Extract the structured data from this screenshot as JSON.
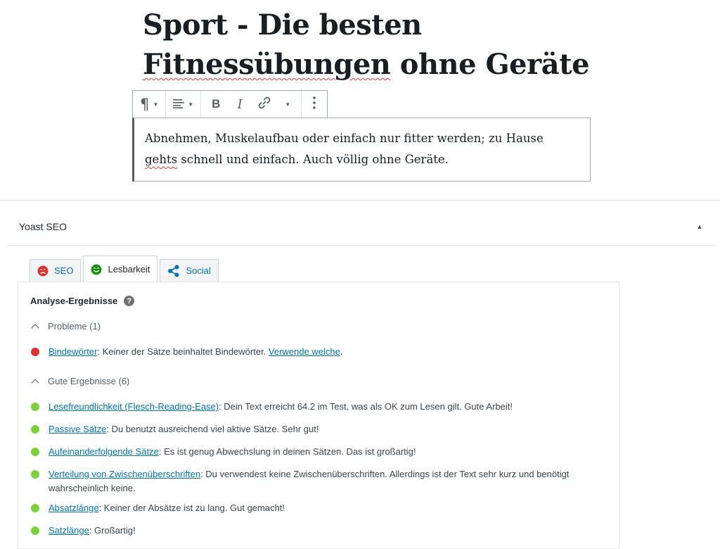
{
  "editor": {
    "title_line1": "Sport - Die besten",
    "title_word_misspelled": "Fitnessübungen",
    "title_line2_rest": " ohne Geräte",
    "paragraph_part1": "Abnehmen, Muskelaufbau oder einfach nur fitter werden; zu Hause ",
    "paragraph_misspelled": "gehts",
    "paragraph_part2": " schnell und einfach. Auch völlig ohne Geräte.",
    "toolbar": {
      "paragraph_icon": "pilcrow-icon",
      "align_icon": "align-left-icon",
      "bold_label": "B",
      "italic_label": "I",
      "link_icon": "link-icon",
      "more_icon": "more-vertical-icon"
    }
  },
  "yoast": {
    "panel_title": "Yoast SEO",
    "tabs": [
      {
        "label": "SEO",
        "icon": "sad-face-icon",
        "color": "#dc3232"
      },
      {
        "label": "Lesbarkeit",
        "icon": "smile-face-icon",
        "color": "#1e8e0e"
      },
      {
        "label": "Social",
        "icon": "share-icon",
        "color": "#0073aa"
      }
    ],
    "analysis_title": "Analyse-Ergebnisse",
    "problems": {
      "heading": "Probleme (1)",
      "items": [
        {
          "link": "Bindewörter",
          "text": ": Keiner der Sätze beinhaltet Bindewörter. ",
          "link2": "Verwende welche",
          "text2": "."
        }
      ]
    },
    "good": {
      "heading": "Gute Ergebnisse (6)",
      "items": [
        {
          "link": "Lesefreundlichkeit (Flesch-Reading-Ease)",
          "text": ": Dein Text erreicht 64.2 im Test, was als OK zum Lesen gilt. Gute Arbeit!"
        },
        {
          "link": "Passive Sätze",
          "text": ": Du benutzt ausreichend viel aktive Sätze. Sehr gut!"
        },
        {
          "link": "Aufeinanderfolgende Sätze",
          "text": ": Es ist genug Abwechslung in deinen Sätzen. Das ist großartig!"
        },
        {
          "link": "Verteilung von Zwischenüberschriften",
          "text": ": Du verwendest keine Zwischenüberschriften. Allerdings ist der Text sehr kurz und benötigt wahrscheinlich keine."
        },
        {
          "link": "Absatzlänge",
          "text": ": Keiner der Absätze ist zu lang. Gut gemacht!"
        },
        {
          "link": "Satzlänge",
          "text": ": Großartig!"
        }
      ]
    },
    "colors": {
      "problem": "#dc3232",
      "good": "#7ad03a",
      "link": "#0073aa"
    }
  }
}
